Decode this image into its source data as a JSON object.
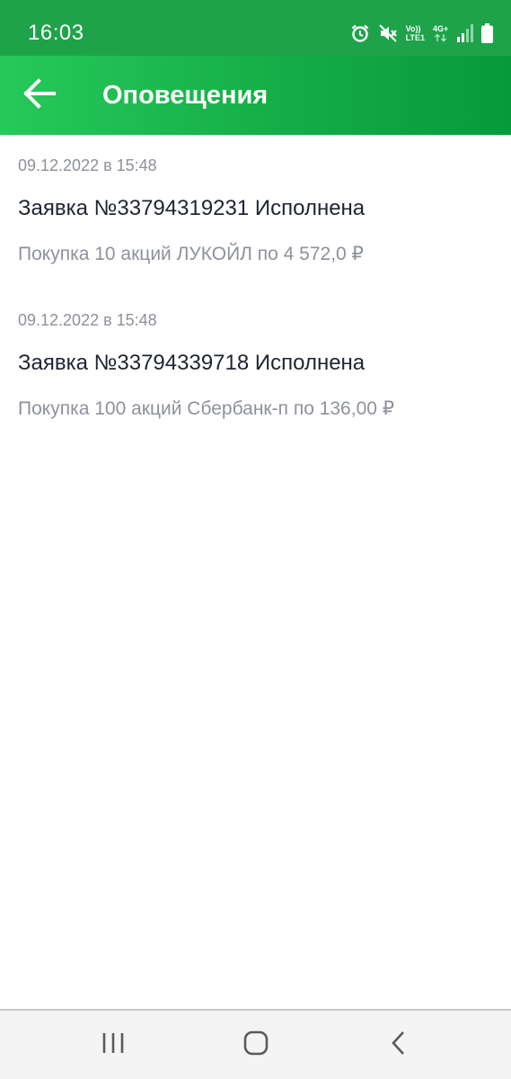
{
  "status_bar": {
    "time": "16:03",
    "icons": [
      "alarm-icon",
      "mute-icon",
      "volte-icon",
      "mobile-data-icon",
      "signal-icon",
      "battery-icon"
    ],
    "volte_top": "Vo))",
    "volte_bottom": "LTE1",
    "network_type": "4G+"
  },
  "app_bar": {
    "back_icon": "arrow-left-icon",
    "title": "Оповещения"
  },
  "notifications": [
    {
      "date": "09.12.2022 в 15:48",
      "title": "Заявка №33794319231 Исполнена",
      "description": "Покупка 10 акций ЛУКОЙЛ по 4 572,0 ₽"
    },
    {
      "date": "09.12.2022 в 15:48",
      "title": "Заявка №33794339718 Исполнена",
      "description": "Покупка 100 акций Сбербанк-п по 136,00 ₽"
    }
  ],
  "nav_bar": {
    "icons": [
      "recent-apps-icon",
      "home-icon",
      "back-icon"
    ]
  },
  "colors": {
    "status_bar": "#1ea34a",
    "app_bar_start": "#27c95a",
    "app_bar_end": "#079a3c",
    "title_text": "#1f2430",
    "secondary_text": "#8d9199"
  }
}
